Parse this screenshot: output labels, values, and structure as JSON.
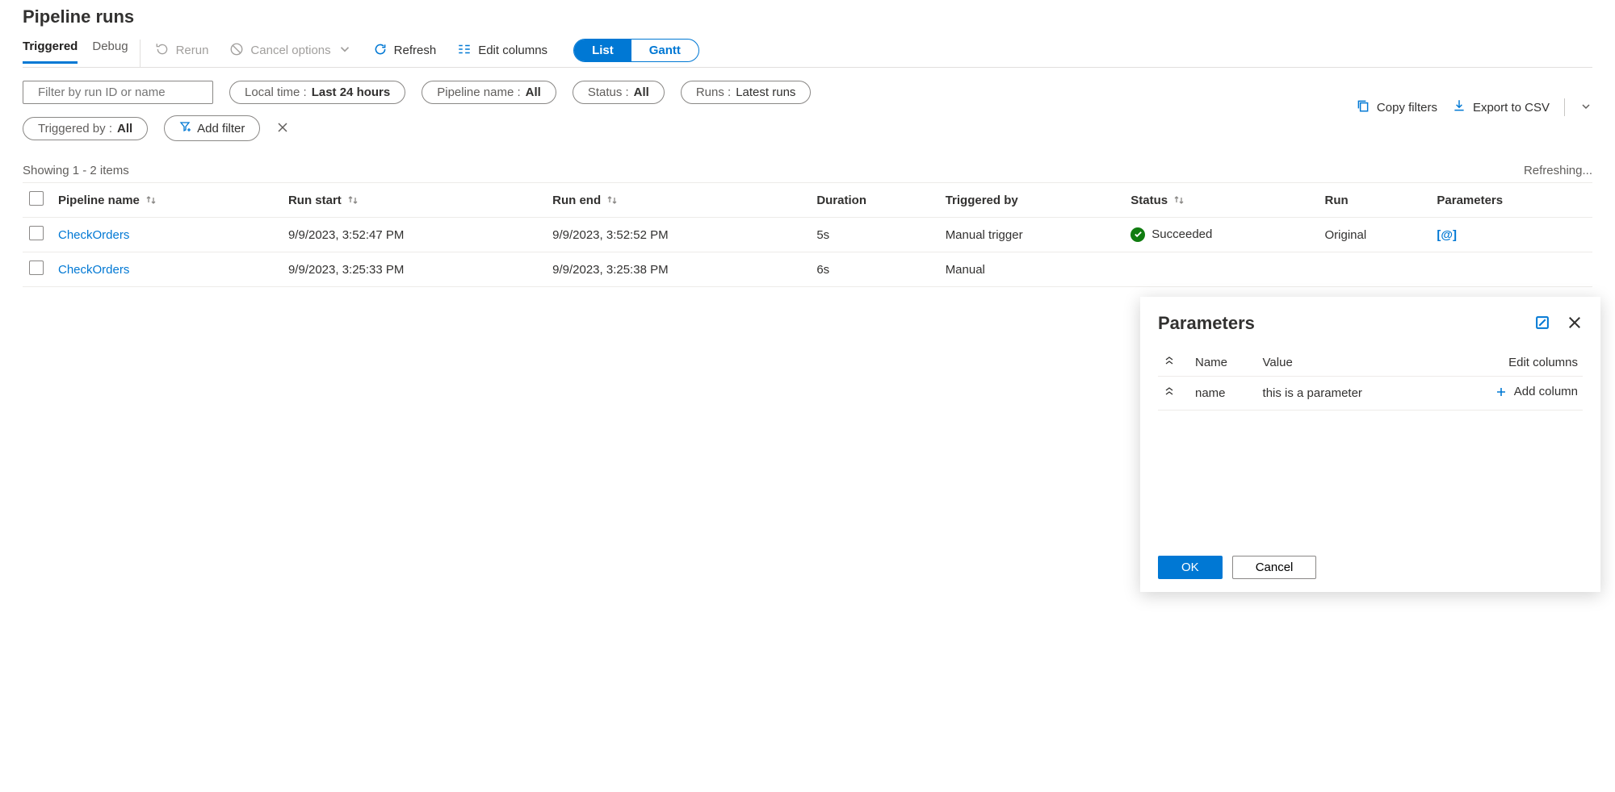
{
  "title": "Pipeline runs",
  "tabs": {
    "triggered": "Triggered",
    "debug": "Debug"
  },
  "toolbar": {
    "rerun": "Rerun",
    "cancel": "Cancel options",
    "refresh": "Refresh",
    "editcols": "Edit columns",
    "list": "List",
    "gantt": "Gantt"
  },
  "filters": {
    "input_placeholder": "Filter by run ID or name",
    "localtime_k": "Local time : ",
    "localtime_v": "Last 24 hours",
    "pipeline_k": "Pipeline name : ",
    "pipeline_v": "All",
    "status_k": "Status : ",
    "status_v": "All",
    "runs_k": "Runs : ",
    "runs_v": "Latest runs",
    "triggeredby_k": "Triggered by : ",
    "triggeredby_v": "All",
    "addfilter": "Add filter"
  },
  "right": {
    "copy": "Copy filters",
    "export": "Export to CSV"
  },
  "results": {
    "showing": "Showing 1 - 2 items",
    "refreshing": "Refreshing..."
  },
  "cols": {
    "pipeline": "Pipeline name",
    "start": "Run start",
    "end": "Run end",
    "duration": "Duration",
    "triggeredby": "Triggered by",
    "status": "Status",
    "run": "Run",
    "params": "Parameters"
  },
  "rows": [
    {
      "pipeline": "CheckOrders",
      "start": "9/9/2023, 3:52:47 PM",
      "end": "9/9/2023, 3:52:52 PM",
      "duration": "5s",
      "triggeredby": "Manual trigger",
      "status": "Succeeded",
      "run": "Original",
      "params_icon": "[@]"
    },
    {
      "pipeline": "CheckOrders",
      "start": "9/9/2023, 3:25:33 PM",
      "end": "9/9/2023, 3:25:38 PM",
      "duration": "6s",
      "triggeredby": "Manual",
      "status": "",
      "run": "",
      "params_icon": ""
    }
  ],
  "popover": {
    "title": "Parameters",
    "col_name": "Name",
    "col_value": "Value",
    "col_editcols": "Edit columns",
    "row_name": "name",
    "row_value": "this is a parameter",
    "addcol": "Add column",
    "ok": "OK",
    "cancel": "Cancel"
  }
}
